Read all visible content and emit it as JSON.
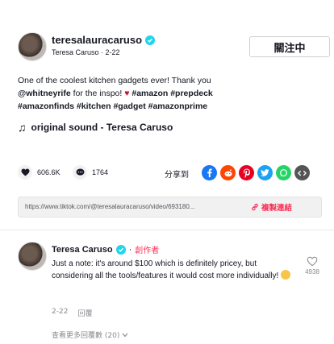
{
  "post": {
    "username": "teresalauracaruso",
    "display_name": "Teresa Caruso",
    "date": "2-22",
    "follow_label": "關注中",
    "caption_parts": {
      "text1": "One of the coolest kitchen gadgets ever! Thank you",
      "mention": "@whitneyrife",
      "text2": " for the inspo! ",
      "heart": "♥",
      "tags_line2": " #amazon #prepdeck",
      "tags_line3": "#amazonfinds #kitchen #gadget #amazonprime"
    },
    "music": "original sound - Teresa Caruso"
  },
  "actions": {
    "likes": "606.6K",
    "comments": "1764",
    "share_label": "分享到"
  },
  "share_icons": [
    {
      "name": "facebook-icon",
      "color": "#1877f2"
    },
    {
      "name": "reddit-icon",
      "color": "#ff4500"
    },
    {
      "name": "pinterest-icon",
      "color": "#e60023"
    },
    {
      "name": "twitter-icon",
      "color": "#1da1f2"
    },
    {
      "name": "whatsapp-icon",
      "color": "#25d366"
    },
    {
      "name": "embed-icon",
      "color": "#555555"
    }
  ],
  "link": {
    "url": "https://www.tiktok.com/@teresalauracaruso/video/693180...",
    "copy_label": "複製連結"
  },
  "comment": {
    "author": "Teresa Caruso",
    "separator": "·",
    "creator_label": "創作者",
    "text": "Just a note: it's around $100 which is definitely pricey, but considering all the tools/features it would cost more individually!",
    "date": "2-22",
    "reply_label": "回覆",
    "more_replies": "查看更多回覆數 (20)",
    "like_count": "4938"
  },
  "colors": {
    "accent": "#fe2c55",
    "verified": "#20d5ec",
    "text": "#161823",
    "muted": "#8a8b91"
  }
}
